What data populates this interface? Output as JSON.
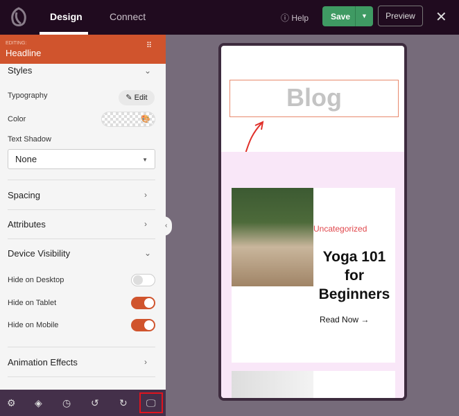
{
  "topbar": {
    "tabs": [
      "Design",
      "Connect"
    ],
    "help": "Help",
    "save": "Save",
    "preview": "Preview"
  },
  "panel": {
    "editing_label": "EDITING:",
    "element": "Headline",
    "styles": "Styles",
    "typography": "Typography",
    "edit": "Edit",
    "color": "Color",
    "text_shadow": "Text Shadow",
    "text_shadow_value": "None",
    "spacing": "Spacing",
    "attributes": "Attributes",
    "device_visibility": "Device Visibility",
    "toggles": [
      {
        "label": "Hide on Desktop",
        "on": false
      },
      {
        "label": "Hide on Tablet",
        "on": true
      },
      {
        "label": "Hide on Mobile",
        "on": true
      }
    ],
    "animation": "Animation Effects"
  },
  "preview": {
    "headline": "Blog",
    "category": "Uncategorized",
    "post_title": "Yoga 101 for Beginners",
    "read_more": "Read Now →"
  },
  "colors": {
    "accent": "#d0542d",
    "save": "#3f9a63",
    "topbar": "#200b1f"
  }
}
